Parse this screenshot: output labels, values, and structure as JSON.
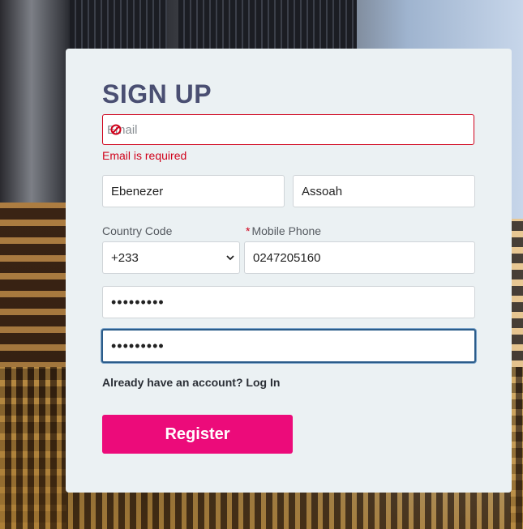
{
  "form": {
    "title": "SIGN UP",
    "email": {
      "placeholder": "Email",
      "value": ""
    },
    "email_error": "Email is required",
    "first_name": {
      "value": "Ebenezer"
    },
    "last_name": {
      "value": "Assoah"
    },
    "country_code": {
      "label": "Country Code",
      "selected": "+233"
    },
    "mobile_phone": {
      "label": "Mobile Phone",
      "required_mark": "*",
      "value": "0247205160"
    },
    "password": {
      "masked": "•••••••••"
    },
    "confirm_password": {
      "masked": "•••••••••"
    },
    "login_link": "Already have an account? Log In",
    "register_button": "Register"
  },
  "colors": {
    "accent": "#ec0b7a",
    "title": "#4a4f72",
    "error": "#d0021b",
    "card_bg": "#ebf1f3",
    "focus": "#2b5c8a"
  }
}
